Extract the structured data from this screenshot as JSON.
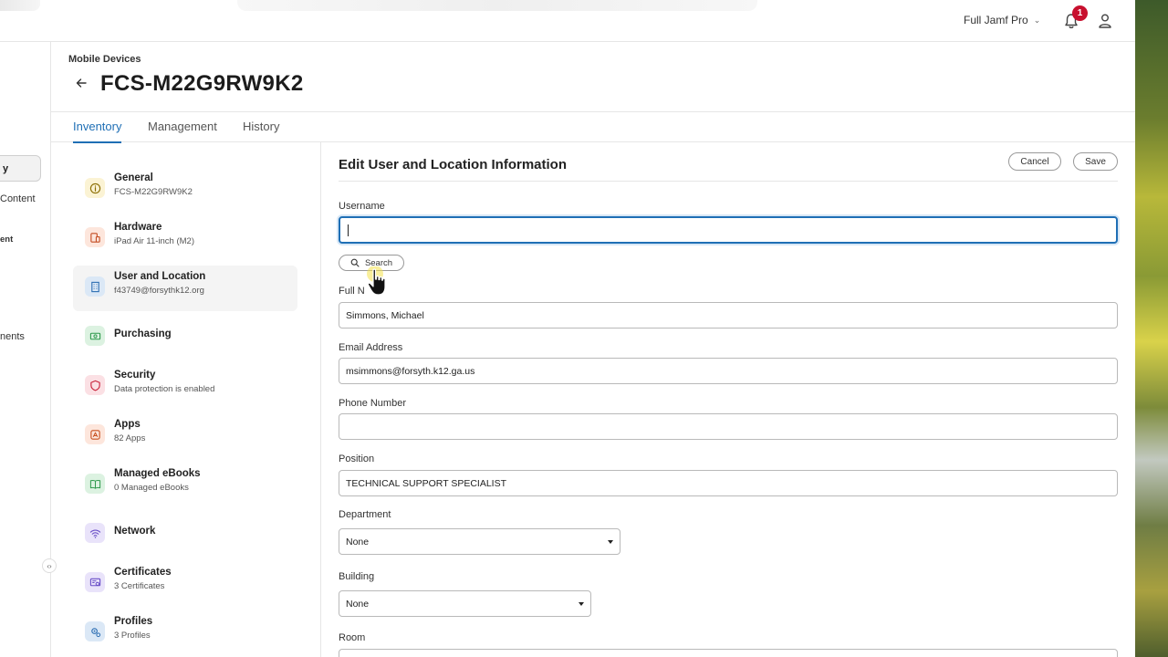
{
  "topbar": {
    "environment": "Full Jamf Pro",
    "notification_count": "1"
  },
  "leftnav": {
    "active_label": "y",
    "items": [
      "Content",
      "ent",
      "nents"
    ]
  },
  "header": {
    "breadcrumb": "Mobile Devices",
    "title": "FCS-M22G9RW9K2"
  },
  "tabs": [
    {
      "label": "Inventory",
      "active": true
    },
    {
      "label": "Management",
      "active": false
    },
    {
      "label": "History",
      "active": false
    }
  ],
  "sections": [
    {
      "title": "General",
      "subtitle": "FCS-M22G9RW9K2",
      "icon": "info-icon",
      "color": "#b38a00"
    },
    {
      "title": "Hardware",
      "subtitle": "iPad Air 11-inch (M2)",
      "icon": "devices-icon",
      "color": "#d5572b"
    },
    {
      "title": "User and Location",
      "subtitle": "f43749@forsythk12.org",
      "icon": "building-icon",
      "color": "#2e6fb3"
    },
    {
      "title": "Purchasing",
      "subtitle": "",
      "icon": "money-icon",
      "color": "#2f9a4d"
    },
    {
      "title": "Security",
      "subtitle": "Data protection is enabled",
      "icon": "shield-icon",
      "color": "#c8223a"
    },
    {
      "title": "Apps",
      "subtitle": "82 Apps",
      "icon": "apps-icon",
      "color": "#c8501f"
    },
    {
      "title": "Managed eBooks",
      "subtitle": "0 Managed eBooks",
      "icon": "book-icon",
      "color": "#2f9a4d"
    },
    {
      "title": "Network",
      "subtitle": "",
      "icon": "wifi-icon",
      "color": "#6a4fc7"
    },
    {
      "title": "Certificates",
      "subtitle": "3 Certificates",
      "icon": "certificate-icon",
      "color": "#6a4fc7"
    },
    {
      "title": "Profiles",
      "subtitle": "3 Profiles",
      "icon": "profile-gear-icon",
      "color": "#2e6fb3"
    }
  ],
  "form": {
    "title": "Edit User and Location Information",
    "cancel_label": "Cancel",
    "save_label": "Save",
    "username_label": "Username",
    "username_value": "",
    "search_label": "Search",
    "full_name_label": "Full N",
    "full_name_value": "Simmons, Michael",
    "email_label": "Email Address",
    "email_value": "msimmons@forsyth.k12.ga.us",
    "phone_label": "Phone Number",
    "phone_value": "",
    "position_label": "Position",
    "position_value": "TECHNICAL SUPPORT SPECIALIST",
    "department_label": "Department",
    "department_value": "None",
    "building_label": "Building",
    "building_value": "None",
    "room_label": "Room"
  },
  "colors": {
    "accent": "#1f6fb5",
    "badge": "#c8102e"
  }
}
